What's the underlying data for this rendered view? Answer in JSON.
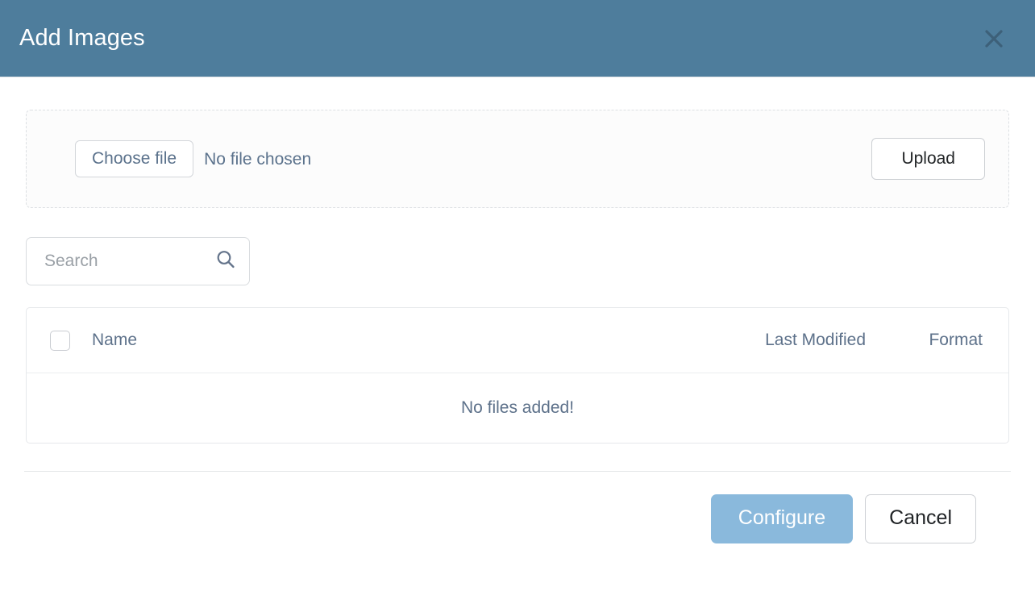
{
  "dialog": {
    "title": "Add Images",
    "close_icon": "close-icon"
  },
  "upload": {
    "choose_file_label": "Choose file",
    "file_status": "No file chosen",
    "upload_label": "Upload"
  },
  "search": {
    "placeholder": "Search",
    "value": "",
    "icon": "search-icon"
  },
  "table": {
    "columns": {
      "name": "Name",
      "last_modified": "Last Modified",
      "format": "Format"
    },
    "select_all_checked": false,
    "rows": [],
    "empty_message": "No files added!"
  },
  "footer": {
    "primary_label": "Configure",
    "secondary_label": "Cancel"
  },
  "colors": {
    "header_bg": "#4e7d9c",
    "primary_button": "#8ab9dc",
    "muted_text": "#5d718a",
    "border": "#e6e8eb"
  }
}
